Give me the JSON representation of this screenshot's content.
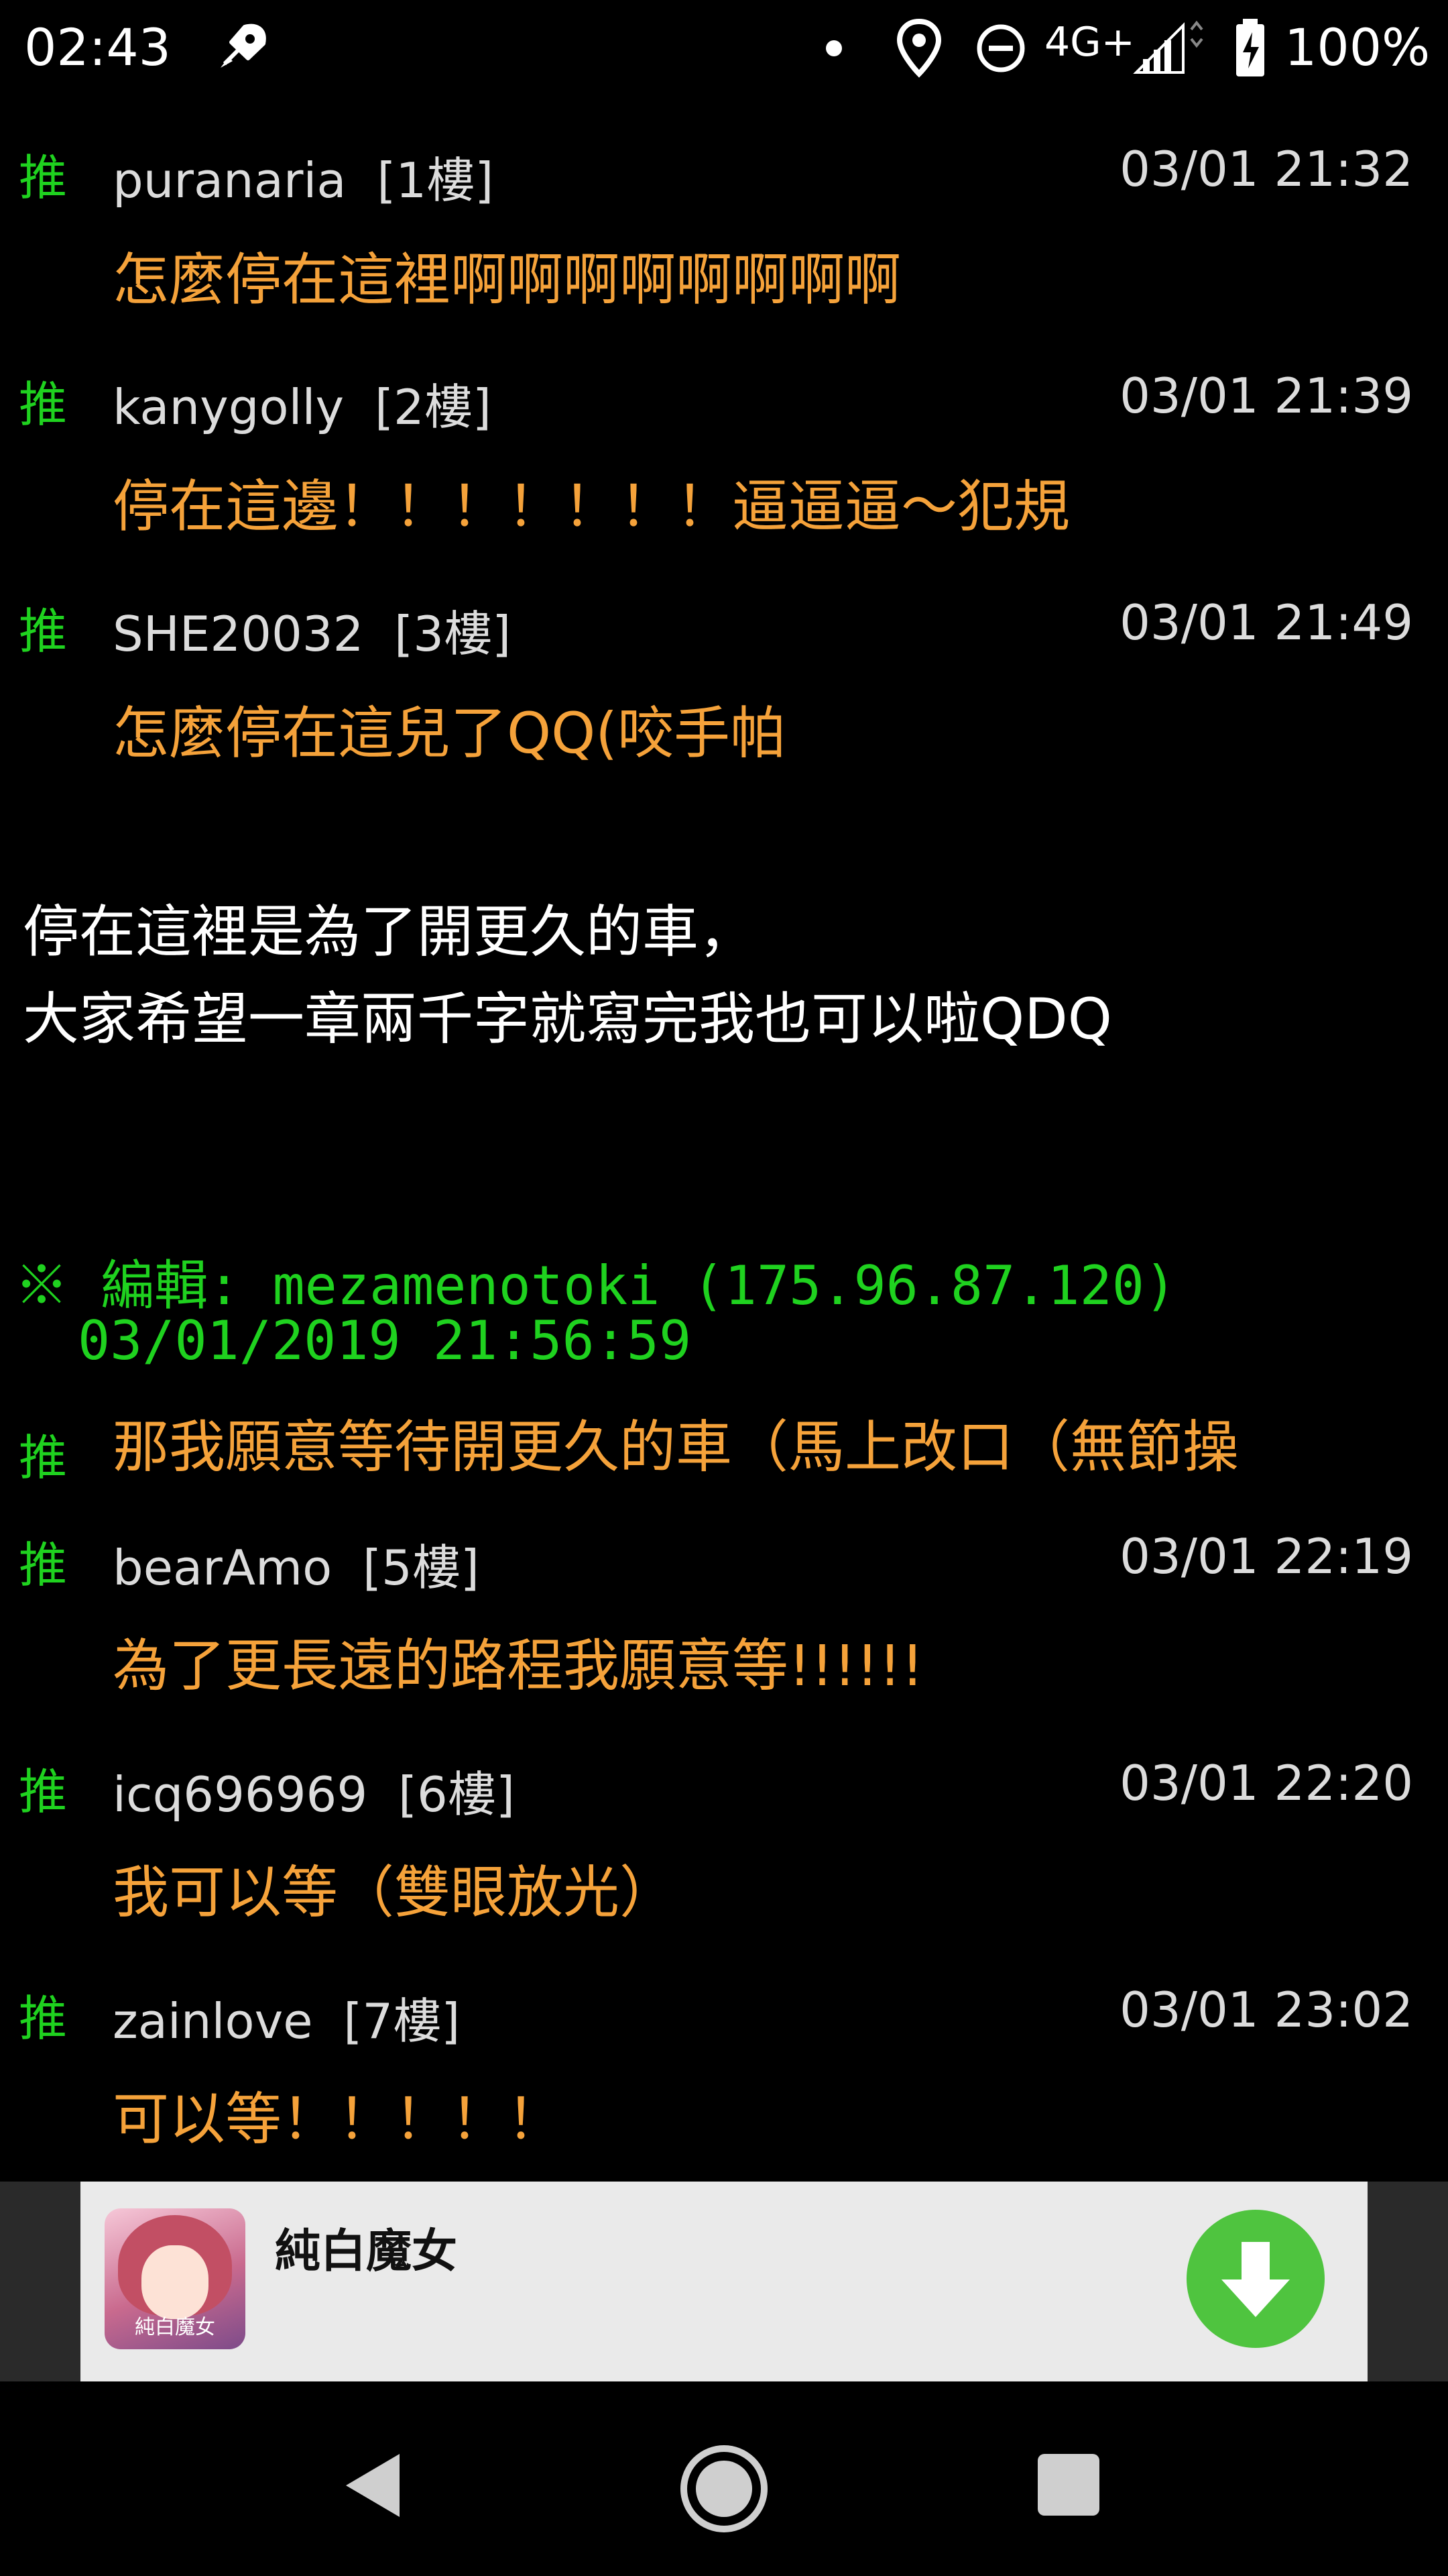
{
  "status_bar": {
    "time": "02:43",
    "network": "4G+",
    "battery": "100%"
  },
  "comments_top": [
    {
      "tag": "推",
      "user": "puranaria",
      "floor": "[1樓]",
      "time": "03/01 21:32",
      "text": "怎麼停在這裡啊啊啊啊啊啊啊啊"
    },
    {
      "tag": "推",
      "user": "kanygolly",
      "floor": "[2樓]",
      "time": "03/01 21:39",
      "text": "停在這邊！！！！！！！逼逼逼～犯規"
    },
    {
      "tag": "推",
      "user": "SHE20032",
      "floor": "[3樓]",
      "time": "03/01 21:49",
      "text": "怎麼停在這兒了QQ(咬手帕"
    }
  ],
  "author_reply": [
    "停在這裡是為了開更久的車，",
    "大家希望一章兩千字就寫完我也可以啦QDQ"
  ],
  "edit_note": {
    "line1": "※ 編輯: mezamenotoki (175.96.87.120)",
    "line2": "03/01/2019 21:56:59"
  },
  "inline_comment": {
    "tag": "推",
    "text": "那我願意等待開更久的車（馬上改口（無節操"
  },
  "comments_bottom": [
    {
      "tag": "推",
      "user": "bearAmo",
      "floor": "[5樓]",
      "time": "03/01 22:19",
      "text": "為了更長遠的路程我願意等!!!!!!"
    },
    {
      "tag": "推",
      "user": "icq696969",
      "floor": "[6樓]",
      "time": "03/01 22:20",
      "text": "我可以等（雙眼放光）"
    },
    {
      "tag": "推",
      "user": "zainlove",
      "floor": "[7樓]",
      "time": "03/01 23:02",
      "text": "可以等！！！！！"
    }
  ],
  "ad": {
    "title": "純白魔女",
    "icon_text": "純白魔女",
    "icon": "game-app-icon",
    "button_icon": "download-arrow-icon"
  },
  "colors": {
    "push_green": "#1fd21f",
    "comment_orange": "#f5a23a",
    "ad_button": "#4fc43f"
  }
}
